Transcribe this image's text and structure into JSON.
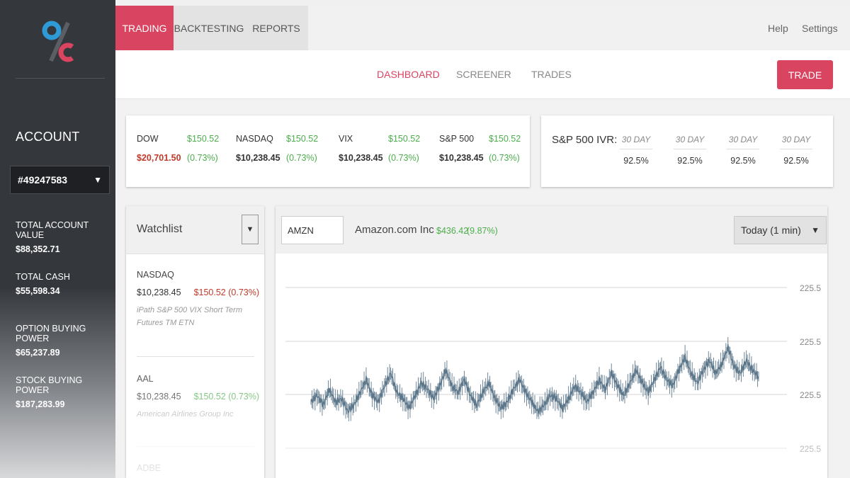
{
  "sidebar": {
    "logo_icon": "percent-c-logo-icon",
    "account_title": "ACCOUNT",
    "account_number": "#49247583",
    "metrics": [
      {
        "label": "TOTAL ACCOUNT VALUE",
        "value": "$88,352.71"
      },
      {
        "label": "TOTAL CASH",
        "value": "$55,598.34"
      },
      {
        "label": "OPTION BUYING POWER",
        "value": "$65,237.89"
      },
      {
        "label": "STOCK BUYING POWER",
        "value": "$187,283.99"
      }
    ]
  },
  "topnav": {
    "tabs": [
      {
        "label": "TRADING",
        "active": true
      },
      {
        "label": "BACKTESTING",
        "active": false
      },
      {
        "label": "REPORTS",
        "active": false
      }
    ],
    "help": "Help",
    "settings": "Settings"
  },
  "subnav": {
    "items": [
      {
        "label": "DASHBOARD",
        "active": true
      },
      {
        "label": "SCREENER",
        "active": false
      },
      {
        "label": "TRADES",
        "active": false
      }
    ],
    "trade_button": "TRADE"
  },
  "markets": [
    {
      "name": "DOW",
      "price": "$20,701.50",
      "change": "$150.52",
      "pct": "(0.73%)",
      "price_negative": true
    },
    {
      "name": "NASDAQ",
      "price": "$10,238.45",
      "change": "$150.52",
      "pct": "(0.73%)",
      "price_negative": false
    },
    {
      "name": "VIX",
      "price": "$10,238.45",
      "change": "$150.52",
      "pct": "(0.73%)",
      "price_negative": false
    },
    {
      "name": "S&P 500",
      "price": "$10,238.45",
      "change": "$150.52",
      "pct": "(0.73%)",
      "price_negative": false
    }
  ],
  "ivr": {
    "title": "S&P 500 IVR:",
    "columns": [
      {
        "header": "30 DAY",
        "value": "92.5%"
      },
      {
        "header": "30 DAY",
        "value": "92.5%"
      },
      {
        "header": "30 DAY",
        "value": "92.5%"
      },
      {
        "header": "30 DAY",
        "value": "92.5%"
      }
    ]
  },
  "watchlist": {
    "title": "Watchlist",
    "items": [
      {
        "symbol": "NASDAQ",
        "price": "$10,238.45",
        "change": "$150.52",
        "pct": "(0.73%)",
        "negative": true,
        "description": "iPath S&P 500 VIX Short Term Futures TM ETN"
      },
      {
        "symbol": "AAL",
        "price": "$10,238.45",
        "change": "$150.52",
        "pct": "(0.73%)",
        "negative": false,
        "description": "American Airlines Group Inc"
      },
      {
        "symbol": "ADBE",
        "price": "",
        "change": "",
        "pct": "",
        "negative": false,
        "description": ""
      }
    ]
  },
  "quote": {
    "symbol": "AMZN",
    "company": "Amazon.com Inc",
    "price": "$436.42",
    "pct": "(9.87%)",
    "range": "Today (1 min)"
  },
  "colors": {
    "accent": "#d94461",
    "positive": "#4cae4c",
    "negative": "#c0392b",
    "sidebar": "#34373c",
    "candle": "#6f8799"
  },
  "chart_data": {
    "type": "line",
    "y_tick_labels": [
      "225.5",
      "225.5",
      "225.5",
      "225.5"
    ],
    "series": [
      {
        "values": [
          224.9,
          225.1,
          224.8,
          225.3,
          224.9,
          225.0,
          224.6,
          224.8,
          225.2,
          225.6,
          225.1,
          224.9,
          225.4,
          225.8,
          225.2,
          225.0,
          224.7,
          225.1,
          225.5,
          225.3,
          225.0,
          225.4,
          225.9,
          225.4,
          225.2,
          225.6,
          225.1,
          224.8,
          225.2,
          225.5,
          225.0,
          224.7,
          224.9,
          225.3,
          225.6,
          225.2,
          224.9,
          224.6,
          224.8,
          225.1,
          225.0,
          224.7,
          225.0,
          225.4,
          225.2,
          224.9,
          225.2,
          225.6,
          225.3,
          225.8,
          225.4,
          225.1,
          225.5,
          225.9,
          225.5,
          225.2,
          225.6,
          226.0,
          225.6,
          225.4,
          225.9,
          226.3,
          225.8,
          225.5,
          225.9,
          226.2,
          225.8,
          226.1,
          226.6,
          226.0,
          225.8,
          226.2,
          225.9,
          225.7
        ]
      }
    ]
  }
}
